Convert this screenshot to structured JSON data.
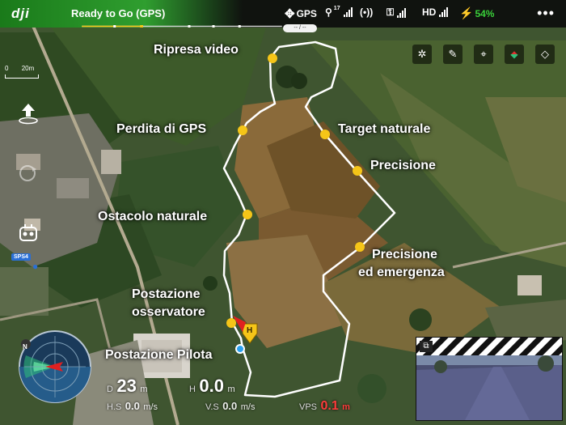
{
  "top_bar": {
    "logo_text": "dji",
    "status": "Ready to Go (GPS)",
    "gps_label": "GPS",
    "gps_satellites": "17",
    "hd_label": "HD",
    "battery_percent": "54%",
    "menu_label": "•••",
    "gps_sub_label": "-- / --",
    "accent_color": "#2f9e2f"
  },
  "map_tools": [
    {
      "name": "settings-icon",
      "glyph": "✲"
    },
    {
      "name": "eraser-icon",
      "glyph": "✎"
    },
    {
      "name": "crosshair-icon",
      "glyph": "⌖"
    },
    {
      "name": "compass-icon",
      "glyph": "◈"
    },
    {
      "name": "layers-icon",
      "glyph": "◇"
    }
  ],
  "scale": {
    "start": "0",
    "end": "20m"
  },
  "waypoints": [
    {
      "id": "ripresa-video",
      "label": "Ripresa video"
    },
    {
      "id": "perdita-gps",
      "label": "Perdita di GPS"
    },
    {
      "id": "target-naturale",
      "label": "Target naturale"
    },
    {
      "id": "precisione",
      "label": "Precisione"
    },
    {
      "id": "ostacolo-naturale",
      "label": "Ostacolo naturale"
    },
    {
      "id": "precisione-emergenza",
      "label_line1": "Precisione",
      "label_line2": "ed emergenza"
    },
    {
      "id": "postazione-osservatore",
      "label_line1": "Postazione",
      "label_line2": "osservatore"
    },
    {
      "id": "postazione-pilota",
      "label": "Postazione Pilota"
    }
  ],
  "home_marker": "H",
  "sps_badge": "SPS4",
  "telemetry": {
    "d_label": "D",
    "d_value": "23",
    "d_unit": "m",
    "h_label": "H",
    "h_value": "0.0",
    "h_unit": "m",
    "hs_label": "H.S",
    "hs_value": "0.0",
    "hs_unit": "m/s",
    "vs_label": "V.S",
    "vs_value": "0.0",
    "vs_unit": "m/s",
    "vps_label": "VPS",
    "vps_value": "0.1",
    "vps_unit": "m"
  },
  "radar": {
    "north_label": "N"
  },
  "colors": {
    "waypoint": "#f5c518",
    "path": "#ffffff",
    "status_green": "#2f9e2f",
    "battery": "#3ad03a",
    "vps_warning": "#ff3b3b"
  }
}
